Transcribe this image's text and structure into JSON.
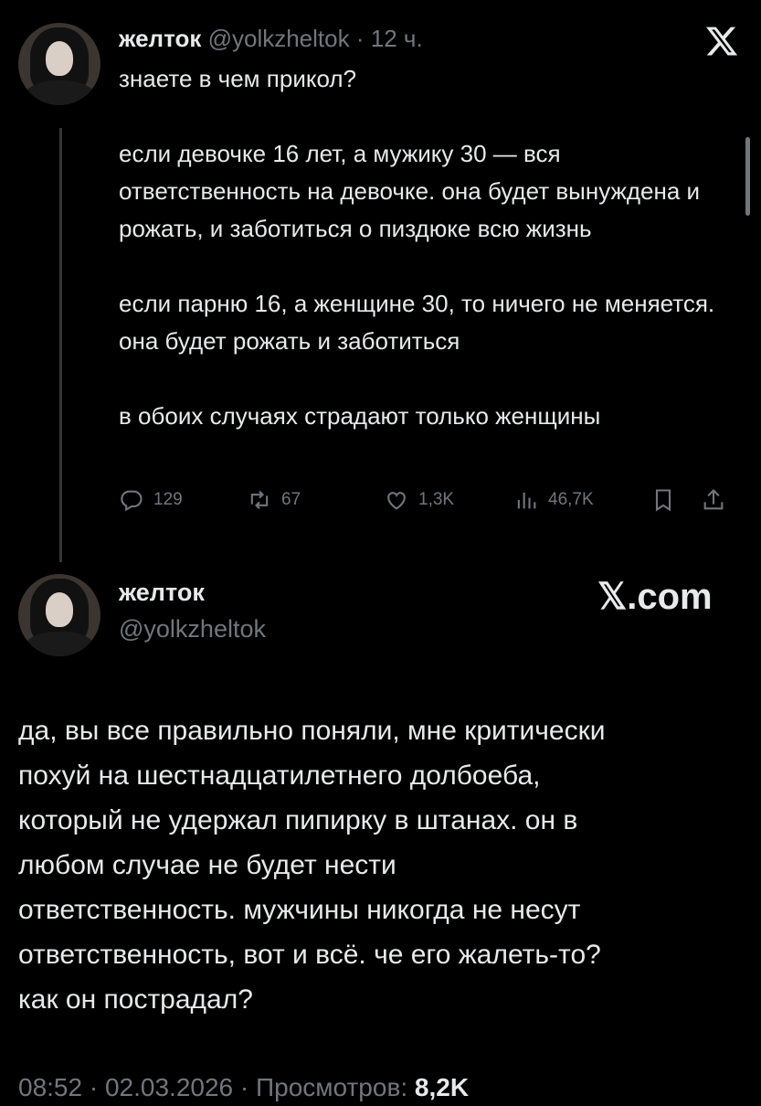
{
  "tweet1": {
    "author_name": "желток",
    "handle": "@yolkzheltok",
    "separator": "·",
    "time": "12 ч.",
    "paragraphs": [
      "знаете в чем прикол?",
      "если девочке 16 лет, а мужику 30 — вся ответственность на девочке. она будет вынуждена и рожать, и заботиться о пиздюке всю жизнь",
      "если парню 16, а женщине 30, то ничего не меняется. она будет рожать и заботиться",
      "в обоих случаях страдают только женщины"
    ],
    "stats": {
      "replies": "129",
      "reposts": "67",
      "likes": "1,3K",
      "views": "46,7K"
    }
  },
  "tweet2": {
    "author_name": "желток",
    "handle": "@yolkzheltok",
    "brand": "𝕏.com",
    "text_lines": [
      "да, вы все правильно поняли, мне критически",
      "похуй на шестнадцатилетнего долбоеба,",
      "который не удержал пипирку в штанах. он в",
      "любом случае не будет нести",
      "ответственность. мужчины никогда не несут",
      "ответственность, вот и всё. че его жалеть-то?",
      "как он пострадал?"
    ],
    "footer": {
      "time": "08:52",
      "sep1": "·",
      "date": "02.03.2026",
      "sep2": "·",
      "views_label": "Просмотров:",
      "views_count": "8,2K"
    }
  },
  "icons": {
    "close": "x-logo-icon",
    "reply": "reply-icon",
    "repost": "repost-icon",
    "like": "like-icon",
    "views": "views-icon",
    "bookmark": "bookmark-icon",
    "share": "share-icon"
  },
  "colors": {
    "background": "#000000",
    "text": "#e7e9ea",
    "muted": "#71767b"
  }
}
